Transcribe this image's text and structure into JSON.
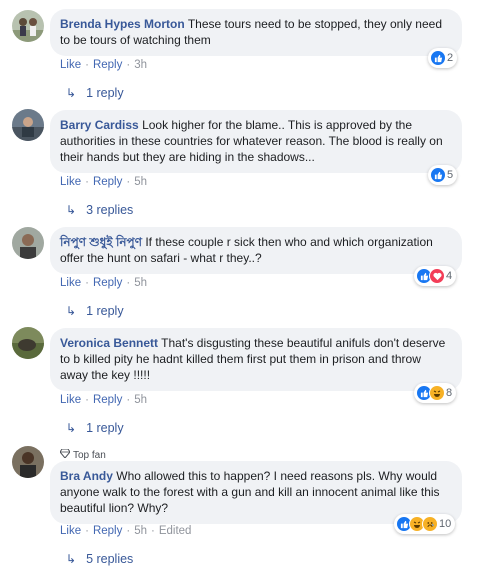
{
  "comments": [
    {
      "author": "Brenda Hypes Morton",
      "text": "These tours need to be stopped, they only need to be tours of watching them",
      "like": "Like",
      "reply": "Reply",
      "time": "3h",
      "reaction_count": "2",
      "replies": "1 reply"
    },
    {
      "author": "Barry Cardiss",
      "text": "Look higher for the blame.. This is approved by the authorities in these countries for whatever reason. The blood is really on their hands but they are hiding in the shadows...",
      "like": "Like",
      "reply": "Reply",
      "time": "5h",
      "reaction_count": "5",
      "replies": "3 replies"
    },
    {
      "author": "নিপুণ শুধুই নিপুণ",
      "text": "If these couple r sick then who and which organization offer the hunt on safari - what r they..?",
      "like": "Like",
      "reply": "Reply",
      "time": "5h",
      "reaction_count": "4",
      "replies": "1 reply"
    },
    {
      "author": "Veronica Bennett",
      "text": "That's disgusting these beautiful anifuls don't deserve to b killed pity he hadnt killed them first put them in prison and throw away the key !!!!!",
      "like": "Like",
      "reply": "Reply",
      "time": "5h",
      "reaction_count": "8",
      "replies": "1 reply"
    },
    {
      "badge": "Top fan",
      "author": "Bra Andy",
      "text": "Who allowed this to happen? I need reasons pls. Why would anyone walk to the forest with a gun and kill an innocent animal like this beautiful lion? Why?",
      "like": "Like",
      "reply": "Reply",
      "time": "5h",
      "edited": "Edited",
      "reaction_count": "10",
      "replies": "5 replies"
    }
  ],
  "colors": {
    "link": "#385898",
    "action": "#4267b2",
    "bubble": "#f0f2f5",
    "like": "#1877f2",
    "love": "#f33e58",
    "haha": "#f7b125"
  },
  "icons": [
    "like-icon",
    "love-icon",
    "haha-icon",
    "sad-icon",
    "reply-arrow-icon",
    "diamond-icon"
  ]
}
